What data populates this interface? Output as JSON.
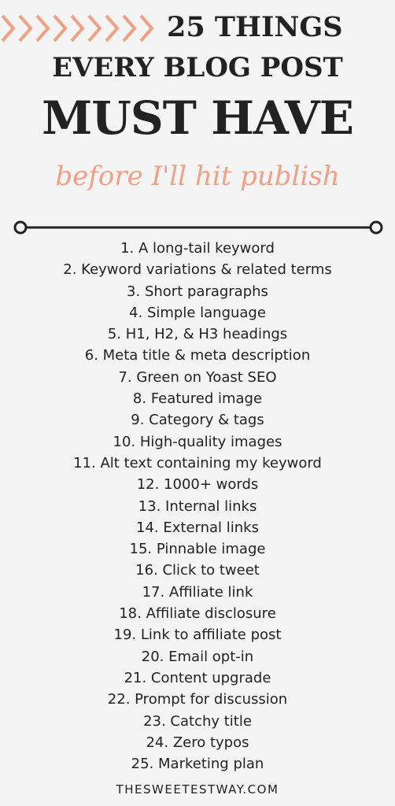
{
  "colors": {
    "accent": "#f0a185",
    "text": "#222222",
    "background": "#f4f4f4"
  },
  "decoration": {
    "chevron_count": 9,
    "chevron_icon": "chevron-right-icon"
  },
  "header": {
    "line1": "25 THINGS",
    "line2": "EVERY BLOG POST",
    "line3": "MUST HAVE",
    "script": "before I'll hit publish"
  },
  "items": [
    "1. A long-tail keyword",
    "2. Keyword variations & related terms",
    "3. Short paragraphs",
    "4. Simple language",
    "5. H1, H2, & H3 headings",
    "6. Meta title & meta description",
    "7. Green on Yoast SEO",
    "8. Featured image",
    "9. Category & tags",
    "10. High-quality images",
    "11. Alt text containing my keyword",
    "12. 1000+ words",
    "13. Internal links",
    "14. External links",
    "15. Pinnable image",
    "16. Click to tweet",
    "17. Affiliate link",
    "18. Affiliate disclosure",
    "19. Link to affiliate post",
    "20. Email opt-in",
    "21. Content upgrade",
    "22. Prompt for discussion",
    "23. Catchy title",
    "24. Zero typos",
    "25. Marketing plan"
  ],
  "footer": "THESWEETESTWAY.COM"
}
